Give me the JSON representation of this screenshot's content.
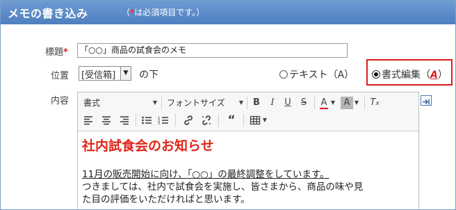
{
  "header": {
    "title": "メモの書き込み",
    "note_open": "（",
    "note_star": "*",
    "note_rest": "は必須項目です。）"
  },
  "form": {
    "title_label": "標題",
    "title_required": "*",
    "title_value": "「○○」商品の試食会のメモ",
    "position_label": "位置",
    "position_select": "[受信箱]",
    "position_suffix": "の下",
    "content_label": "内容",
    "radio_text_label": "テキスト（A）",
    "radio_rich_label_pre": "書式編集（",
    "radio_rich_key": "A",
    "radio_rich_label_post": "）",
    "radio_selected": "rich"
  },
  "toolbar": {
    "format_dropdown": "書式",
    "font_size_dropdown": "フォントサイズ",
    "font_color": "#e01a1a",
    "bg_color": "#888888"
  },
  "content": {
    "heading": "社内試食会のお知らせ",
    "lines": [
      "11月の販売開始に向け、「○○」の最終調整をしています。",
      "つきましては、社内で試食会を実施し、皆さまから、商品の味や見",
      "た目の評価をいただければと思います。"
    ]
  }
}
